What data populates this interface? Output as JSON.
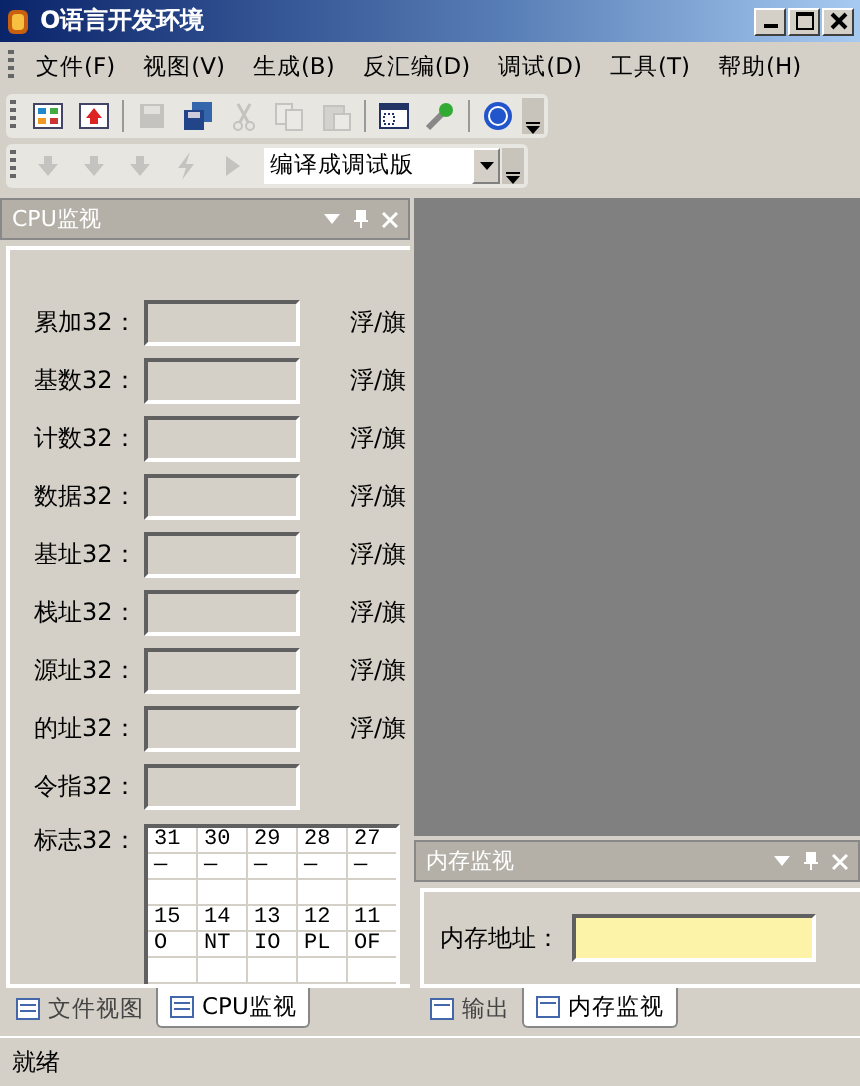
{
  "window": {
    "title": "O语言开发环境"
  },
  "menu": [
    "文件(F)",
    "视图(V)",
    "生成(B)",
    "反汇编(D)",
    "调试(D)",
    "工具(T)",
    "帮助(H)"
  ],
  "toolbar": {
    "groups": [
      {
        "buttons": [
          {
            "disabled": false
          },
          {
            "disabled": false
          }
        ]
      },
      {
        "buttons": [
          {
            "disabled": true
          },
          {
            "disabled": false
          },
          {
            "disabled": true
          },
          {
            "disabled": true
          },
          {
            "disabled": true
          }
        ]
      },
      {
        "buttons": [
          {
            "disabled": false
          },
          {
            "disabled": false
          }
        ]
      },
      {
        "buttons": [
          {
            "disabled": false
          }
        ]
      }
    ]
  },
  "debug_toolbar": {
    "buttons": [
      {
        "disabled": true
      },
      {
        "disabled": true
      },
      {
        "disabled": true
      },
      {
        "disabled": true
      },
      {
        "disabled": true
      }
    ],
    "build_mode": "编译成调试版"
  },
  "cpu_panel": {
    "title": "CPU监视",
    "registers": [
      {
        "label": "累加32：",
        "suffix": "浮/旗"
      },
      {
        "label": "基数32：",
        "suffix": "浮/旗"
      },
      {
        "label": "计数32：",
        "suffix": "浮/旗"
      },
      {
        "label": "数据32：",
        "suffix": "浮/旗"
      },
      {
        "label": "基址32：",
        "suffix": "浮/旗"
      },
      {
        "label": "栈址32：",
        "suffix": "浮/旗"
      },
      {
        "label": "源址32：",
        "suffix": "浮/旗"
      },
      {
        "label": "的址32：",
        "suffix": "浮/旗"
      },
      {
        "label": "令指32："
      }
    ],
    "flags_label": "标志32：",
    "flag_groups": [
      {
        "bits": [
          "31",
          "30",
          "29",
          "28",
          "27"
        ],
        "values": [
          "—",
          "—",
          "—",
          "—",
          "—"
        ]
      },
      {
        "bits": [
          "15",
          "14",
          "13",
          "12",
          "11"
        ],
        "values": [
          "O",
          "NT",
          "IO",
          "PL",
          "OF"
        ]
      }
    ]
  },
  "left_tabs": [
    {
      "label": "文件视图",
      "selected": false
    },
    {
      "label": "CPU监视",
      "selected": true
    }
  ],
  "memory_panel": {
    "title": "内存监视",
    "address_label": "内存地址："
  },
  "bottom_tabs": [
    {
      "label": "输出",
      "selected": false
    },
    {
      "label": "内存监视",
      "selected": true
    }
  ],
  "status_bar": "就绪"
}
